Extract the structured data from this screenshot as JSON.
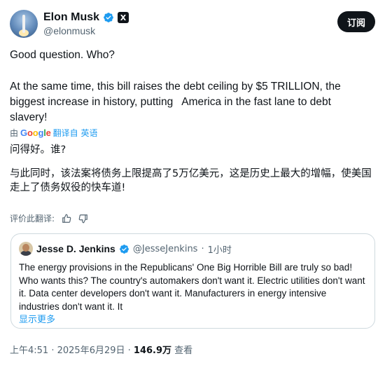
{
  "tweet": {
    "author": {
      "name": "Elon Musk",
      "handle": "@elonmusk",
      "verified": true,
      "affiliation_badge": "X"
    },
    "subscribe_label": "订阅",
    "text_line1": "Good question. Who?",
    "text_line2": "At the same time, this bill raises the debt ceiling by $5 TRILLION, the biggest increase in history, putting   America in the fast lane to debt slavery!",
    "translation": {
      "by_label": "由",
      "provider": "Google",
      "translated_from": "翻译自 英语",
      "line1": "问得好。谁?",
      "line2": "与此同时，该法案将债务上限提高了5万亿美元，这是历史上最大的增幅，使美国走上了债务奴役的快车道!"
    },
    "rate_label": "评价此翻译:",
    "quote": {
      "name": "Jesse D. Jenkins",
      "handle": "@JesseJenkins",
      "dot": "·",
      "time": "1小时",
      "text": "The energy provisions in the Republicans' One Big Horrible Bill are truly so bad! Who wants this? The country's automakers don't want it.  Electric utilities don't want it. Data center developers don't want it. Manufacturers in energy intensive industries don't want it. It",
      "show_more": "显示更多"
    },
    "meta": {
      "time": "上午4:51",
      "sep": " · ",
      "date": "2025年6月29日",
      "sep2": " · ",
      "views": "146.9万",
      "views_label": " 查看"
    }
  },
  "colors": {
    "link": "#1d9bf0",
    "verified": "#1d9bf0",
    "muted": "#536471",
    "text": "#0f1419"
  },
  "icons": [
    "verified-badge-icon",
    "x-logo-icon",
    "thumbs-up-icon",
    "thumbs-down-icon"
  ]
}
